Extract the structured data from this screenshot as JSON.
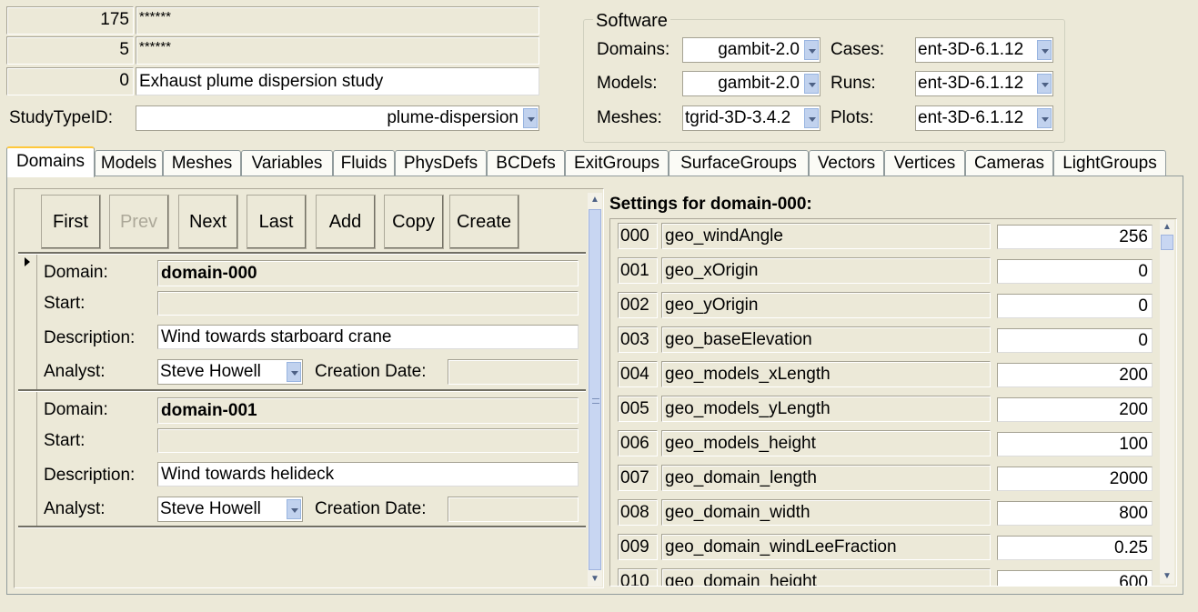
{
  "header": {
    "fields": [
      {
        "num": "175",
        "text": "******"
      },
      {
        "num": "5",
        "text": "******"
      },
      {
        "num": "0",
        "text": "Exhaust plume dispersion study"
      }
    ],
    "study_type_label": "StudyTypeID:",
    "study_type_value": "plume-dispersion"
  },
  "software": {
    "legend": "Software",
    "rows": [
      {
        "label_a": "Domains:",
        "value_a": "gambit-2.0",
        "label_b": "Cases:",
        "value_b": "ent-3D-6.1.12"
      },
      {
        "label_a": "Models:",
        "value_a": "gambit-2.0",
        "label_b": "Runs:",
        "value_b": "ent-3D-6.1.12"
      },
      {
        "label_a": "Meshes:",
        "value_a": "tgrid-3D-3.4.2",
        "label_b": "Plots:",
        "value_b": "ent-3D-6.1.12"
      }
    ]
  },
  "tabs": [
    "Domains",
    "Models",
    "Meshes",
    "Variables",
    "Fluids",
    "PhysDefs",
    "BCDefs",
    "ExitGroups",
    "SurfaceGroups",
    "Vectors",
    "Vertices",
    "Cameras",
    "LightGroups"
  ],
  "active_tab": "Domains",
  "nav_buttons": [
    "First",
    "Prev",
    "Next",
    "Last",
    "Add",
    "Copy",
    "Create"
  ],
  "labels": {
    "domain": "Domain:",
    "start": "Start:",
    "description": "Description:",
    "analyst": "Analyst:",
    "creation_date": "Creation Date:"
  },
  "records": [
    {
      "domain": "domain-000",
      "start": "",
      "description": "Wind towards starboard crane",
      "analyst": "Steve Howell",
      "creation_date": ""
    },
    {
      "domain": "domain-001",
      "start": "",
      "description": "Wind towards helideck",
      "analyst": "Steve Howell",
      "creation_date": ""
    }
  ],
  "settings": {
    "title": "Settings for domain-000:",
    "rows": [
      {
        "id": "000",
        "name": "geo_windAngle",
        "value": "256"
      },
      {
        "id": "001",
        "name": "geo_xOrigin",
        "value": "0"
      },
      {
        "id": "002",
        "name": "geo_yOrigin",
        "value": "0"
      },
      {
        "id": "003",
        "name": "geo_baseElevation",
        "value": "0"
      },
      {
        "id": "004",
        "name": "geo_models_xLength",
        "value": "200"
      },
      {
        "id": "005",
        "name": "geo_models_yLength",
        "value": "200"
      },
      {
        "id": "006",
        "name": "geo_models_height",
        "value": "100"
      },
      {
        "id": "007",
        "name": "geo_domain_length",
        "value": "2000"
      },
      {
        "id": "008",
        "name": "geo_domain_width",
        "value": "800"
      },
      {
        "id": "009",
        "name": "geo_domain_windLeeFraction",
        "value": "0.25"
      },
      {
        "id": "010",
        "name": "geo_domain_height",
        "value": "600"
      }
    ]
  },
  "icons": {
    "record_selector": "triangle-right-icon",
    "dropdown": "chevron-down-icon",
    "scroll_up": "arrow-up-icon",
    "scroll_down": "arrow-down-icon"
  }
}
